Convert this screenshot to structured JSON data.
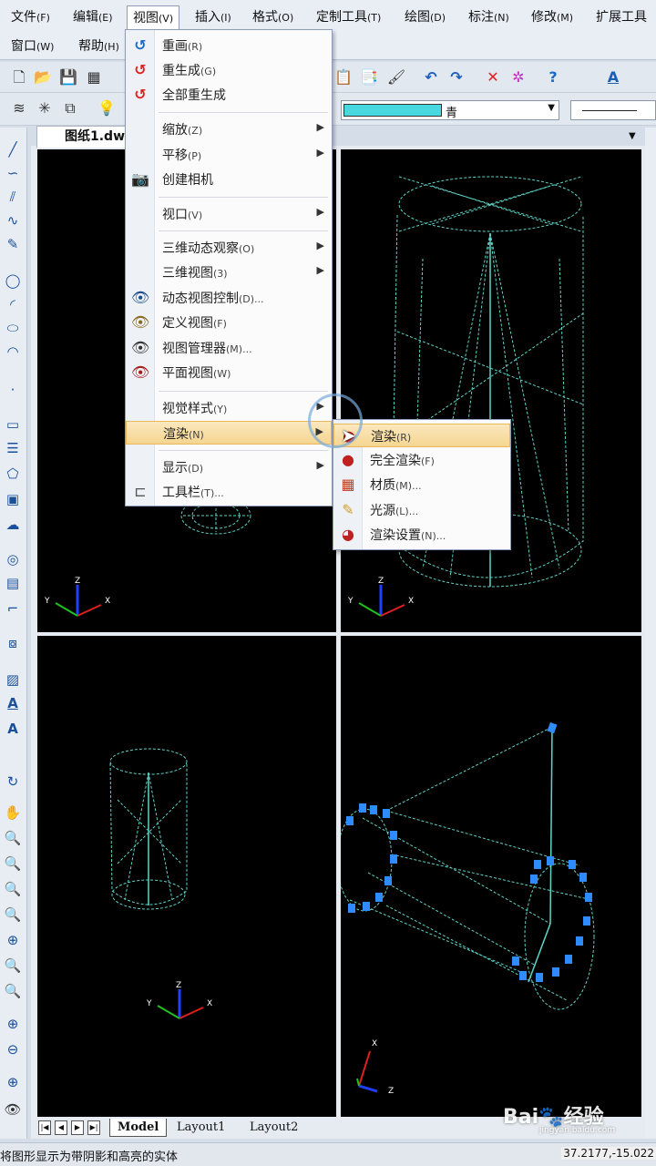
{
  "menubar": {
    "row1": [
      {
        "label": "文件",
        "acc": "(F)"
      },
      {
        "label": "编辑",
        "acc": "(E)"
      },
      {
        "label": "视图",
        "acc": "(V)"
      },
      {
        "label": "插入",
        "acc": "(I)"
      },
      {
        "label": "格式",
        "acc": "(O)"
      },
      {
        "label": "定制工具",
        "acc": "(T)"
      },
      {
        "label": "绘图",
        "acc": "(D)"
      },
      {
        "label": "标注",
        "acc": "(N)"
      },
      {
        "label": "修改",
        "acc": "(M)"
      },
      {
        "label": "扩展工具",
        "acc": ""
      }
    ],
    "row2": [
      {
        "label": "窗口",
        "acc": "(W)"
      },
      {
        "label": "帮助",
        "acc": "(H)"
      }
    ]
  },
  "toolbar": {
    "color_value": "青",
    "color_swatch": "#48d8e0"
  },
  "document": {
    "tab_title": "图纸1.dw"
  },
  "view_menu": {
    "items": [
      {
        "label": "重画",
        "acc": "(R)",
        "icon": "redraw-icon",
        "submenu": false
      },
      {
        "label": "重生成",
        "acc": "(G)",
        "icon": "regen-icon",
        "submenu": false
      },
      {
        "label": "全部重生成",
        "acc": "",
        "icon": "regen-all-icon",
        "submenu": false
      },
      {
        "label": "缩放",
        "acc": "(Z)",
        "icon": "",
        "submenu": true
      },
      {
        "label": "平移",
        "acc": "(P)",
        "icon": "",
        "submenu": true
      },
      {
        "label": "创建相机",
        "acc": "",
        "icon": "camera-icon",
        "submenu": false
      },
      {
        "label": "视口",
        "acc": "(V)",
        "icon": "",
        "submenu": true
      },
      {
        "label": "三维动态观察",
        "acc": "(O)",
        "icon": "",
        "submenu": true
      },
      {
        "label": "三维视图",
        "acc": "(3)",
        "icon": "",
        "submenu": true
      },
      {
        "label": "动态视图控制",
        "acc": "(D)...",
        "icon": "dynamic-view-icon",
        "submenu": false
      },
      {
        "label": "定义视图",
        "acc": "(F)",
        "icon": "define-view-icon",
        "submenu": false
      },
      {
        "label": "视图管理器",
        "acc": "(M)...",
        "icon": "view-manager-icon",
        "submenu": false
      },
      {
        "label": "平面视图",
        "acc": "(W)",
        "icon": "plan-view-icon",
        "submenu": false
      },
      {
        "label": "视觉样式",
        "acc": "(Y)",
        "icon": "",
        "submenu": true
      },
      {
        "label": "渲染",
        "acc": "(N)",
        "icon": "",
        "submenu": true
      },
      {
        "label": "显示",
        "acc": "(D)",
        "icon": "",
        "submenu": true
      },
      {
        "label": "工具栏",
        "acc": "(T)...",
        "icon": "toolbar-icon",
        "submenu": false
      }
    ]
  },
  "render_menu": {
    "items": [
      {
        "label": "渲染",
        "acc": "(R)",
        "icon": "render-icon"
      },
      {
        "label": "完全渲染",
        "acc": "(F)",
        "icon": "full-render-icon"
      },
      {
        "label": "材质",
        "acc": "(M)...",
        "icon": "material-icon"
      },
      {
        "label": "光源",
        "acc": "(L)...",
        "icon": "light-icon"
      },
      {
        "label": "渲染设置",
        "acc": "(N)...",
        "icon": "render-settings-icon"
      }
    ]
  },
  "axes": {
    "x": "X",
    "y": "Y",
    "z": "Z"
  },
  "layout_tabs": [
    "Model",
    "Layout1",
    "Layout2"
  ],
  "status": {
    "message": "将图形显示为带阴影和高亮的实体",
    "coords": "37.2177,-15.022"
  },
  "watermark": {
    "brand": "Bai",
    "brand2": "经验",
    "url": "jingyan.baidu.com"
  }
}
